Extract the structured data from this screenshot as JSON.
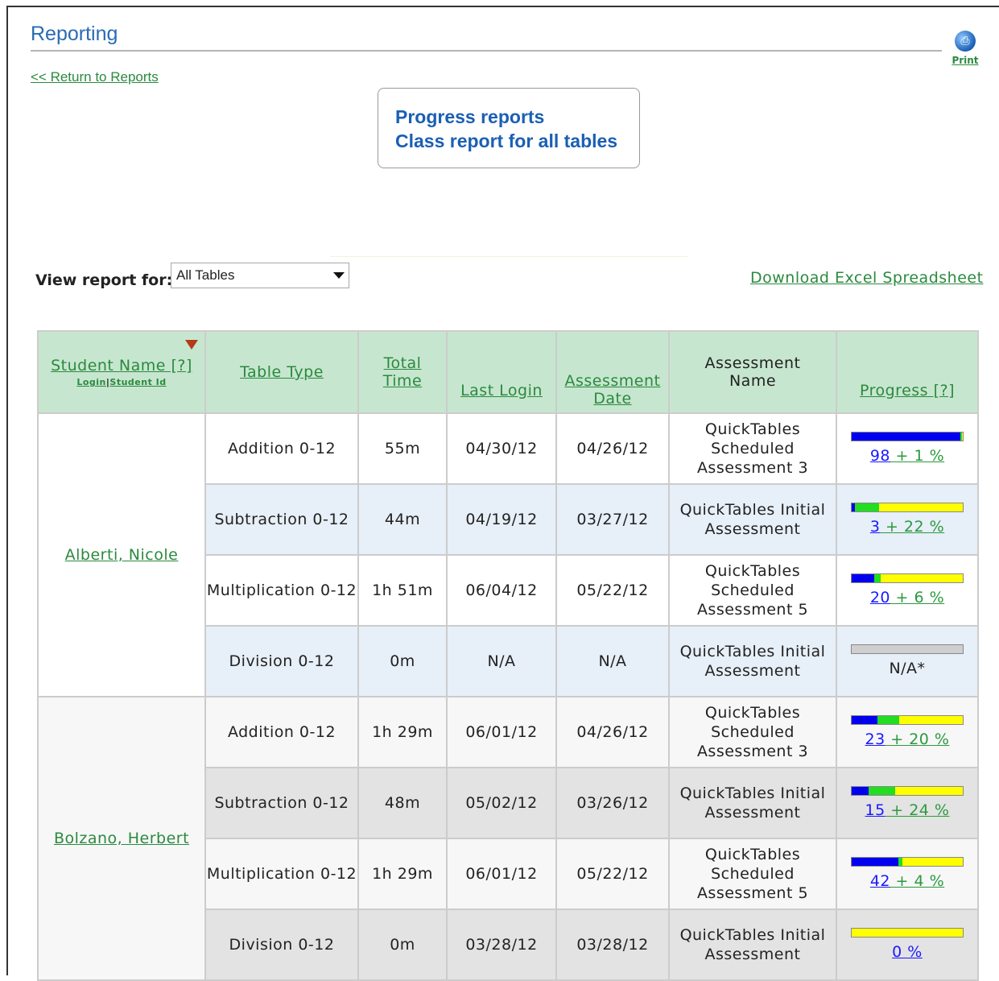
{
  "page": {
    "title": "Reporting",
    "print_label": "Print",
    "return_link": "<< Return to Reports",
    "report_box": {
      "line1": "Progress reports",
      "line2": "Class report for all tables"
    },
    "view_label": "View report for:",
    "select_value": "All Tables",
    "download_link": "Download Excel Spreadsheet"
  },
  "table": {
    "headers": {
      "student_name": "Student Name [?]",
      "login": "Login",
      "sep": "|",
      "student_id": "Student Id",
      "table_type": "Table Type",
      "total_time_1": "Total",
      "total_time_2": "Time",
      "last_login": "Last Login",
      "assessment_date_1": "Assessment",
      "assessment_date_2": "Date",
      "assessment_name_1": "Assessment",
      "assessment_name_2": "Name",
      "progress": "Progress [?]"
    },
    "students": [
      {
        "name": "Alberti, Nicole",
        "rows": [
          {
            "type": "Addition 0-12",
            "time": "55m",
            "last_login": "04/30/12",
            "assess_date": "04/26/12",
            "assess_name": "QuickTables Scheduled Assessment 3",
            "blue": 98,
            "green": 1,
            "blue_label": "98",
            "green_label": " + 1 %"
          },
          {
            "type": "Subtraction 0-12",
            "time": "44m",
            "last_login": "04/19/12",
            "assess_date": "03/27/12",
            "assess_name": "QuickTables Initial Assessment",
            "blue": 3,
            "green": 22,
            "blue_label": "3",
            "green_label": " + 22 %"
          },
          {
            "type": "Multiplication 0-12",
            "time": "1h 51m",
            "last_login": "06/04/12",
            "assess_date": "05/22/12",
            "assess_name": "QuickTables Scheduled Assessment 5",
            "blue": 20,
            "green": 6,
            "blue_label": "20",
            "green_label": " + 6 %"
          },
          {
            "type": "Division 0-12",
            "time": "0m",
            "last_login": "N/A",
            "assess_date": "N/A",
            "assess_name": "QuickTables Initial Assessment",
            "na": true,
            "na_label": "N/A*"
          }
        ]
      },
      {
        "name": "Bolzano, Herbert",
        "rows": [
          {
            "type": "Addition 0-12",
            "time": "1h 29m",
            "last_login": "06/01/12",
            "assess_date": "04/26/12",
            "assess_name": "QuickTables Scheduled Assessment 3",
            "blue": 23,
            "green": 20,
            "blue_label": "23",
            "green_label": " + 20 %"
          },
          {
            "type": "Subtraction 0-12",
            "time": "48m",
            "last_login": "05/02/12",
            "assess_date": "03/26/12",
            "assess_name": "QuickTables Initial Assessment",
            "blue": 15,
            "green": 24,
            "blue_label": "15",
            "green_label": " + 24 %"
          },
          {
            "type": "Multiplication 0-12",
            "time": "1h 29m",
            "last_login": "06/01/12",
            "assess_date": "05/22/12",
            "assess_name": "QuickTables Scheduled Assessment 5",
            "blue": 42,
            "green": 4,
            "blue_label": "42",
            "green_label": " + 4 %"
          },
          {
            "type": "Division 0-12",
            "time": "0m",
            "last_login": "03/28/12",
            "assess_date": "03/28/12",
            "assess_name": "QuickTables Initial Assessment",
            "blue": 0,
            "green": 0,
            "blue_label": "0 %",
            "green_label": ""
          }
        ]
      }
    ]
  },
  "colors": {
    "accent_blue": "#2a6bb3",
    "link_green": "#2b8a3e",
    "header_green": "#c7e6cf",
    "bar_blue": "#0000ee",
    "bar_green": "#22dd22",
    "bar_yellow": "#ffff00"
  }
}
